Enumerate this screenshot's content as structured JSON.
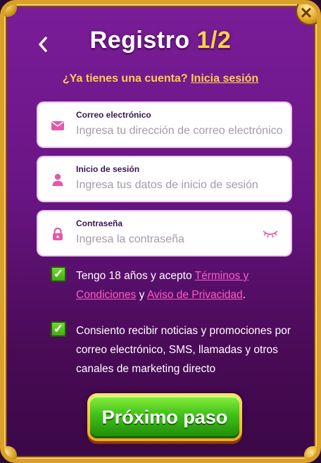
{
  "header": {
    "title": "Registro",
    "step": "1/2",
    "back_icon": "chevron-left-icon",
    "close_icon": "close-icon"
  },
  "account_prompt": {
    "text": "¿Ya tienes una cuenta?",
    "link_label": "Inicia sesión"
  },
  "form": {
    "email": {
      "label": "Correo electrónico",
      "placeholder": "Ingresa tu dirección de correo electrónico",
      "icon": "envelope-icon"
    },
    "login": {
      "label": "Inicio de sesión",
      "placeholder": "Ingresa tus datos de inicio de sesión",
      "icon": "user-icon"
    },
    "password": {
      "label": "Contraseña",
      "placeholder": "Ingresa la contraseña",
      "icon": "lock-icon",
      "toggle_icon": "eye-closed-icon"
    }
  },
  "consents": {
    "age": {
      "checked": true,
      "text_before": "Tengo 18 años y acepto",
      "terms_link": "Términos y Condiciones",
      "text_middle": "y",
      "privacy_link": "Aviso de Privacidad",
      "text_after": "."
    },
    "marketing": {
      "checked": true,
      "text": "Consiento recibir noticias y promociones por correo electrónico, SMS, llamadas y otros canales de marketing directo"
    }
  },
  "actions": {
    "next_label": "Próximo paso"
  },
  "colors": {
    "accent_yellow": "#ffcf4a",
    "link_pink": "#ff5ac8",
    "icon_pink": "#e25aa8",
    "button_green": "#3fc01a",
    "frame_gold": "#d9a02a"
  }
}
